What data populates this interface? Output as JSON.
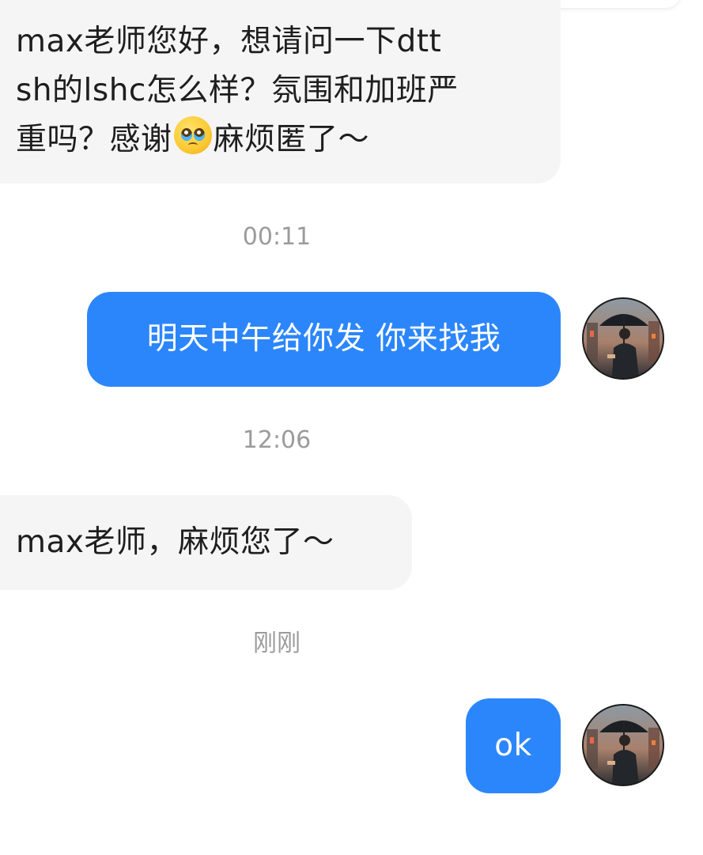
{
  "conversation": {
    "messages": [
      {
        "direction": "incoming",
        "lines": [
          "max老师您好，想请问一下dtt",
          "sh的lshc怎么样？氛围和加班严",
          "重吗？感谢",
          "麻烦匿了～"
        ],
        "emoji": "pleading-face-emoji"
      },
      {
        "direction": "outgoing",
        "text": "明天中午给你发 你来找我"
      },
      {
        "direction": "incoming",
        "text": "max老师，麻烦您了～"
      },
      {
        "direction": "outgoing",
        "text": "ok"
      }
    ],
    "timestamps": [
      "00:11",
      "12:06",
      "刚刚"
    ]
  },
  "avatar": {
    "icon": "man-with-umbrella-avatar"
  },
  "colors": {
    "outgoing_bubble": "#2c86fb",
    "incoming_bubble": "#f5f5f5",
    "timestamp_text": "#9b9b9b",
    "background": "#ffffff"
  }
}
